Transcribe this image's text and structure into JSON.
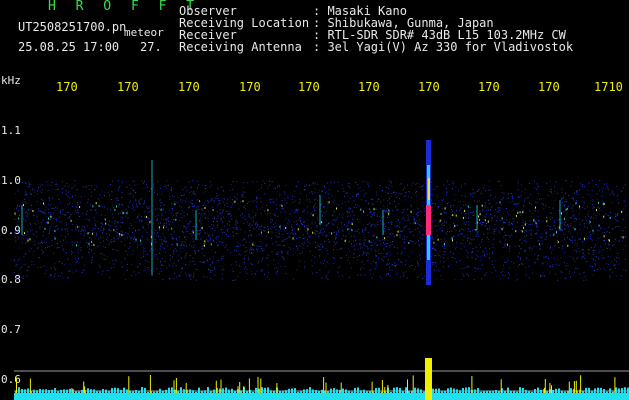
{
  "header": {
    "brand": "H R O F F T",
    "file_name": "UT2508251700.pn",
    "file_type": "meteor",
    "datetime": "25.08.25 17:00",
    "count": "27.",
    "fields": [
      {
        "label": "Observer",
        "value": ": Masaki Kano"
      },
      {
        "label": "Receiving Location",
        "value": ": Shibukawa, Gunma, Japan"
      },
      {
        "label": "Receiver",
        "value": ": RTL-SDR SDR# 43dB L15 103.2MHz CW"
      },
      {
        "label": "Receiving Antenna",
        "value": ": 3el Yagi(V) Az 330 for Vladivostok"
      }
    ]
  },
  "axes": {
    "y_unit": "kHz",
    "y_ticks": [
      "1.1",
      "1.0",
      "0.9",
      "0.8",
      "0.7",
      "0.6"
    ],
    "x_ticks": [
      "170",
      "170",
      "170",
      "170",
      "170",
      "170",
      "170",
      "170",
      "170",
      "1710"
    ]
  },
  "colors": {
    "background": "#000000",
    "noise": "#1a2bd8",
    "meteor_core": "#ff2a7a",
    "meteor_halo": "#25d0e8",
    "baseline": "#20e0f0",
    "peaks": "#f0f000",
    "guide": "#9a9a9a"
  }
}
